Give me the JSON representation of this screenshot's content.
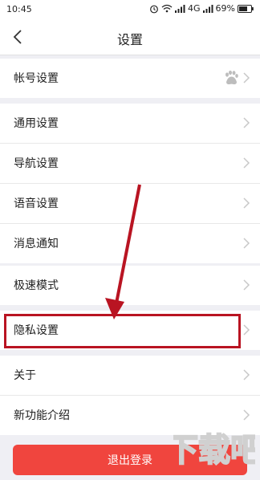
{
  "status_bar": {
    "time": "10:45",
    "network": "4G",
    "battery": "69%",
    "icons": [
      "alarm-icon",
      "wifi-icon",
      "signal-icon",
      "battery-icon"
    ]
  },
  "nav": {
    "title": "设置",
    "back_icon": "chevron-left-icon"
  },
  "groups": [
    {
      "items": [
        {
          "label": "帐号设置",
          "accessory_icon": "baidu-paw-icon"
        }
      ]
    },
    {
      "items": [
        {
          "label": "通用设置"
        },
        {
          "label": "导航设置"
        },
        {
          "label": "语音设置"
        },
        {
          "label": "消息通知"
        }
      ]
    },
    {
      "items": [
        {
          "label": "极速模式"
        }
      ]
    },
    {
      "items": [
        {
          "label": "隐私设置",
          "highlighted": true
        }
      ]
    },
    {
      "items": [
        {
          "label": "关于"
        },
        {
          "label": "新功能介绍"
        }
      ]
    }
  ],
  "logout": {
    "label": "退出登录"
  },
  "colors": {
    "page_bg": "#efeff4",
    "accent_red": "#f0453e",
    "annotation_red": "#b91422",
    "chevron": "#c8c8c8"
  },
  "watermark": {
    "text": "下载吧"
  }
}
